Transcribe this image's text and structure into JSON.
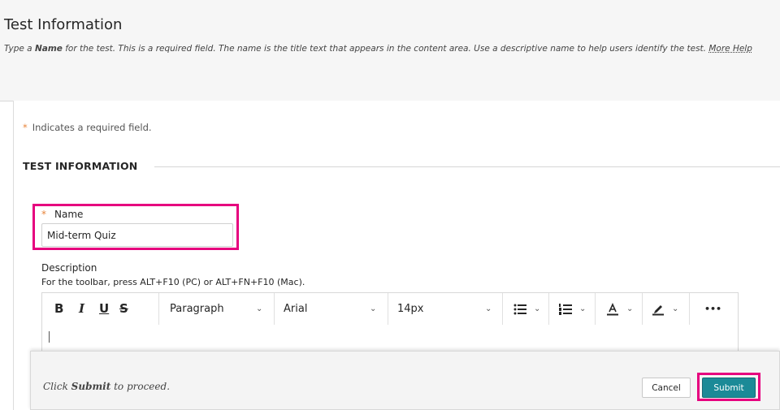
{
  "header": {
    "title": "Test Information",
    "desc_pre": "Type a ",
    "desc_bold": "Name",
    "desc_post": " for the test. This is a required field. The name is the title text that appears in the content area. Use a descriptive name to help users identify the test. ",
    "more_help": "More Help"
  },
  "form": {
    "required_note": "Indicates a required field.",
    "section_title": "TEST INFORMATION",
    "name_label": "Name",
    "name_value": "Mid-term Quiz",
    "description_label": "Description",
    "toolbar_hint": "For the toolbar, press ALT+F10 (PC) or ALT+FN+F10 (Mac)."
  },
  "editor_toolbar": {
    "bold": "B",
    "italic": "I",
    "underline": "U",
    "strike": "S",
    "paragraph": "Paragraph",
    "font": "Arial",
    "size": "14px",
    "more": "•••",
    "icons": [
      "bold-icon",
      "italic-icon",
      "underline-icon",
      "strikethrough-icon",
      "bullet-list-icon",
      "numbered-list-icon",
      "text-color-icon",
      "highlight-icon",
      "more-icon"
    ]
  },
  "submit_bar": {
    "hint_pre": "Click ",
    "hint_bold": "Submit",
    "hint_post": " to proceed.",
    "cancel_label": "Cancel",
    "submit_label": "Submit"
  },
  "colors": {
    "accent": "#e6007e",
    "submit": "#1b8a97",
    "required_star": "#e8853b"
  }
}
